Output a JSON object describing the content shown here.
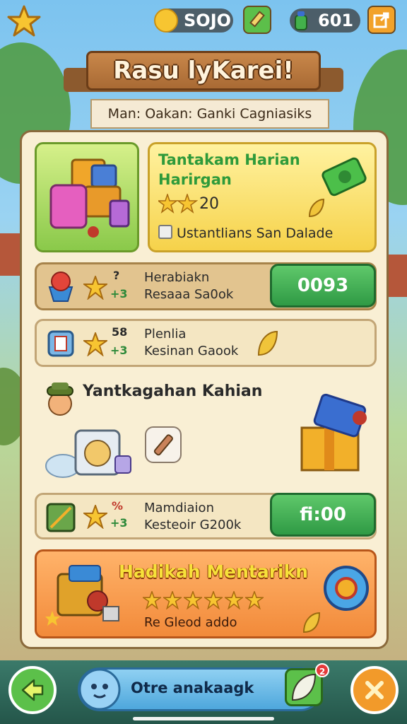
{
  "resources": {
    "coins": "SOJO",
    "gems": "601"
  },
  "header": {
    "title": "Rasu lyKarei!",
    "subtitle": "Man: Oakan: Ganki Cagniasiks"
  },
  "featured_offer": {
    "title_line1": "Tantakam Harian",
    "title_line2": "Harirgan",
    "star_value": "20",
    "option_label": "Ustantlians San Dalade"
  },
  "reward_rows": [
    {
      "line1": "Herabiakn",
      "line2": "Resaaa Sa0ok",
      "stat_top": "?",
      "stat_bottom": "+3",
      "button_label": "0093"
    },
    {
      "line1": "Plenlia",
      "line2": "Kesinan Gaook",
      "stat_top": "58",
      "stat_bottom": "+3"
    }
  ],
  "middle_section": {
    "title": "Yantkagahan Kahian"
  },
  "row3": {
    "line1": "Mamdiaion",
    "line2": "Kesteoir G200k",
    "stat_top": "%",
    "stat_bottom": "+3",
    "button_label": "fi:00"
  },
  "bonus": {
    "title": "Hadikah Mentarikn",
    "star_count": 6,
    "footer": "Re Gleod addo"
  },
  "bottom": {
    "center_label": "Otre anakaagk",
    "notification_count": "2"
  },
  "colors": {
    "accent_green": "#2f9a45",
    "accent_orange": "#f28a3a",
    "panel": "#f9efd4",
    "gold": "#f7c531"
  }
}
